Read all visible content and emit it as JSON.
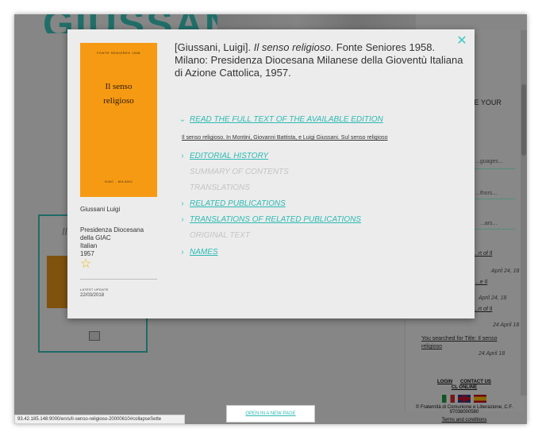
{
  "background": {
    "logo_text": "GIUSSANI",
    "card_title": "Il",
    "sidebar": {
      "love_your": "...OVE YOUR",
      "links": [
        "...guages...",
        "...thors...",
        "...ars..."
      ],
      "items": [
        {
          "text": "...rt of Il",
          "date": "April 24, 18"
        },
        {
          "text": "...e Il",
          "date": "April 24, 18"
        },
        {
          "text": "...rt of Il",
          "date": "24 April 18"
        },
        {
          "text": "You searched for Title: Il senso religioso",
          "date": "24 April 18"
        }
      ]
    },
    "footer": {
      "login": "LOGIN",
      "contact": "CONTACT US",
      "cl_online": "CL ONLINE",
      "copyright": "© Fraternità di Comunione e Liberazione, C.F. 97038000580",
      "terms": "Terms and conditions"
    },
    "open_new_page": "OPEN IN A NEW PAGE",
    "status_url": "93.42.185.148:9000/en/s/il-senso-religioso-20000610#collapseSette"
  },
  "modal": {
    "close_icon": "close-icon",
    "cover": {
      "top_text": "FONTE SENIORES 1958",
      "title_line1": "Il senso",
      "title_line2": "religioso",
      "bottom_text": "GIAC - MILANO"
    },
    "author": "Giussani Luigi",
    "publisher": "Presidenza Diocesana della GIAC",
    "language": "Italian",
    "year": "1957",
    "latest_update_label": "LATEST UPDATE",
    "latest_update_date": "22/03/2018",
    "citation": {
      "prefix": "[Giussani, Luigi]. ",
      "title": "Il senso religioso",
      "suffix": ". Fonte Seniores 1958. Milano: Presidenza Diocesana Milanese della Gioventù Italiana di Azione Cattolica, 1957."
    },
    "sections": {
      "read_full": "READ THE FULL TEXT OF THE AVAILABLE EDITION",
      "read_full_link": "Il senso religioso. In Montini, Giovanni Battista, e Luigi Giussani. Sul senso religioso",
      "editorial_history": "EDITORIAL HISTORY",
      "summary": "SUMMARY OF CONTENTS",
      "translations": "TRANSLATIONS",
      "related_publications": "RELATED PUBLICATIONS",
      "translations_related": "TRANSLATIONS OF RELATED PUBLICATIONS",
      "original_text": "ORIGINAL TEXT",
      "names": "NAMES"
    },
    "accent_color": "#2cbab3"
  }
}
